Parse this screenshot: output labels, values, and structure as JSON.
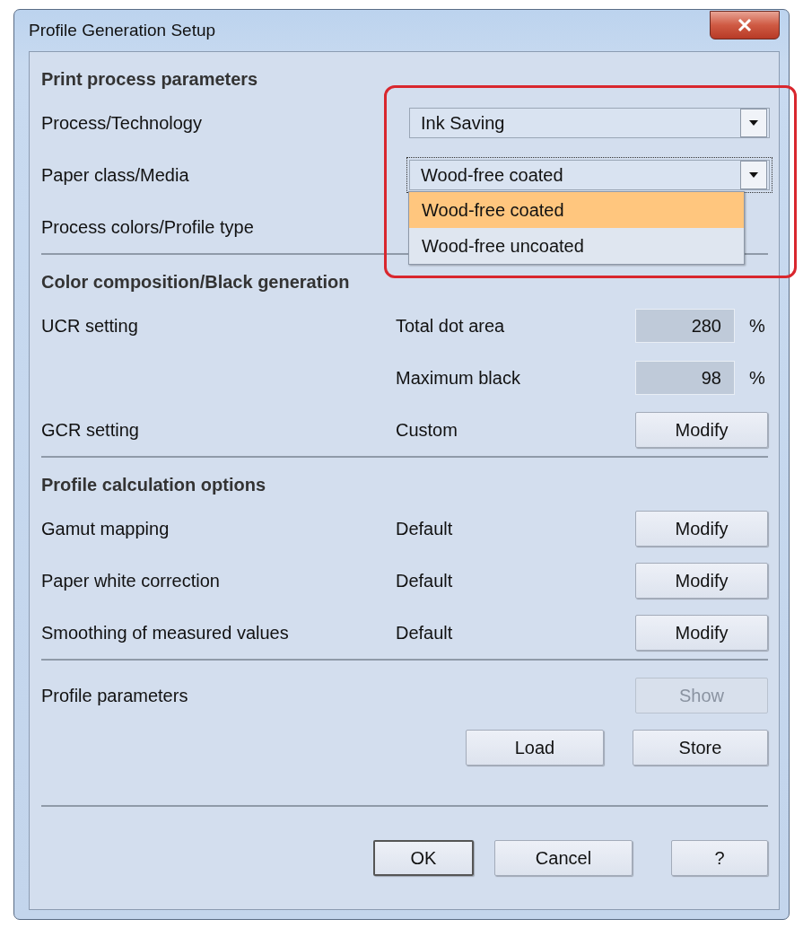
{
  "window": {
    "title": "Profile Generation Setup"
  },
  "sections": [
    {
      "title": "Print process parameters",
      "highlighted": true,
      "rows": [
        {
          "kind": "combo",
          "label": "Process/Technology",
          "value": "Ink Saving",
          "focused": false
        },
        {
          "kind": "combo",
          "label": "Paper class/Media",
          "value": "Wood-free coated",
          "focused": true,
          "options": [
            {
              "label": "Wood-free coated",
              "selected": true
            },
            {
              "label": "Wood-free uncoated",
              "selected": false
            }
          ]
        },
        {
          "kind": "text",
          "label": "Process colors/Profile type"
        }
      ]
    },
    {
      "title": "Color composition/Black generation",
      "rows": [
        {
          "kind": "field",
          "label": "UCR setting",
          "caption": "Total dot area",
          "value": "280",
          "unit": "%"
        },
        {
          "kind": "field",
          "caption": "Maximum black",
          "value": "98",
          "unit": "%"
        },
        {
          "kind": "button",
          "label": "GCR setting",
          "caption": "Custom",
          "button": {
            "label": "Modify",
            "disabled": false
          }
        }
      ]
    },
    {
      "title": "Profile calculation options",
      "rows": [
        {
          "kind": "button",
          "label": "Gamut mapping",
          "caption": "Default",
          "button": {
            "label": "Modify",
            "disabled": false
          }
        },
        {
          "kind": "button",
          "label": "Paper white correction",
          "caption": "Default",
          "button": {
            "label": "Modify",
            "disabled": false
          }
        },
        {
          "kind": "button",
          "label": "Smoothing of measured values",
          "caption": "Default",
          "button": {
            "label": "Modify",
            "disabled": false
          }
        }
      ]
    },
    {
      "rows": [
        {
          "kind": "button",
          "label": "Profile parameters",
          "button": {
            "label": "Show",
            "disabled": true
          }
        },
        {
          "kind": "buttons",
          "buttons": [
            {
              "label": "Load",
              "disabled": false
            },
            {
              "label": "Store",
              "disabled": false
            }
          ]
        }
      ]
    }
  ],
  "footer": [
    {
      "label": "OK",
      "default": true
    },
    {
      "label": "Cancel",
      "default": false
    },
    {
      "label": "?",
      "default": false
    }
  ]
}
